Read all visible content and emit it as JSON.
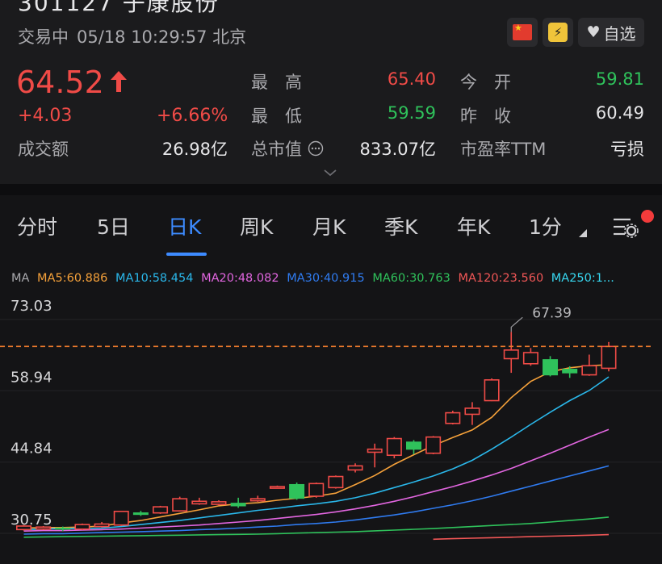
{
  "header": {
    "title_partial": "301127 子康股份",
    "status": "交易中",
    "datetime": "05/18 10:29:57 北京",
    "watch_label": "自选"
  },
  "quote": {
    "price": "64.52",
    "change": "+4.03",
    "change_pct": "+6.66%",
    "turnover_label": "成交额",
    "turnover_value": "26.98亿",
    "high_label": "最　高",
    "high_value": "65.40",
    "open_label": "今　开",
    "open_value": "59.81",
    "low_label": "最　低",
    "low_value": "59.59",
    "prev_close_label": "昨　收",
    "prev_close_value": "60.49",
    "mcap_label": "总市值",
    "mcap_value": "833.07亿",
    "pe_label": "市盈率TTM",
    "pe_value": "亏损"
  },
  "tabs": [
    "分时",
    "5日",
    "日K",
    "周K",
    "月K",
    "季K",
    "年K",
    "1分"
  ],
  "active_tab": "日K",
  "ma": {
    "label": "MA",
    "ma5": "MA5:60.886",
    "ma10": "MA10:58.454",
    "ma20": "MA20:48.082",
    "ma30": "MA30:40.915",
    "ma60": "MA60:30.763",
    "ma120": "MA120:23.560",
    "ma250": "MA250:1..."
  },
  "colors": {
    "up": "#f04b47",
    "down": "#2fc25b",
    "accent": "#3d8bff",
    "ma5": "#f5a13a",
    "ma10": "#2ab7ea",
    "ma20": "#e266e0",
    "ma30": "#2f7bf0",
    "ma60": "#2fc25b",
    "ma120": "#f05656",
    "ma250": "#37d7f0"
  },
  "chart_data": {
    "type": "candlestick",
    "y_ticks": [
      "73.03",
      "58.94",
      "44.84",
      "30.75"
    ],
    "ylim": [
      27.2,
      73.03
    ],
    "max_label": "67.39",
    "current_price_line": 64.52,
    "candles": [
      {
        "o": 28.3,
        "c": 29.0,
        "h": 29.2,
        "l": 28.1
      },
      {
        "o": 28.4,
        "c": 28.8,
        "h": 29.0,
        "l": 28.2
      },
      {
        "o": 28.7,
        "c": 28.3,
        "h": 28.9,
        "l": 28.0
      },
      {
        "o": 28.4,
        "c": 29.3,
        "h": 29.5,
        "l": 28.2
      },
      {
        "o": 28.9,
        "c": 29.4,
        "h": 29.8,
        "l": 28.7
      },
      {
        "o": 29.2,
        "c": 31.9,
        "h": 32.0,
        "l": 29.0
      },
      {
        "o": 31.7,
        "c": 31.2,
        "h": 32.0,
        "l": 31.0
      },
      {
        "o": 31.6,
        "c": 32.8,
        "h": 33.0,
        "l": 31.4
      },
      {
        "o": 32.0,
        "c": 34.4,
        "h": 34.8,
        "l": 31.9
      },
      {
        "o": 33.4,
        "c": 33.9,
        "h": 34.6,
        "l": 33.2
      },
      {
        "o": 33.3,
        "c": 33.8,
        "h": 34.1,
        "l": 33.1
      },
      {
        "o": 33.6,
        "c": 32.9,
        "h": 34.6,
        "l": 32.6
      },
      {
        "o": 34.0,
        "c": 34.4,
        "h": 35.0,
        "l": 33.8
      },
      {
        "o": 36.6,
        "c": 36.8,
        "h": 37.0,
        "l": 36.6
      },
      {
        "o": 37.3,
        "c": 34.4,
        "h": 37.6,
        "l": 34.2
      },
      {
        "o": 34.9,
        "c": 37.4,
        "h": 37.6,
        "l": 34.6
      },
      {
        "o": 36.6,
        "c": 38.8,
        "h": 39.0,
        "l": 36.4
      },
      {
        "o": 40.1,
        "c": 40.9,
        "h": 41.4,
        "l": 39.6
      },
      {
        "o": 43.6,
        "c": 44.2,
        "h": 45.3,
        "l": 40.6
      },
      {
        "o": 43.0,
        "c": 46.3,
        "h": 46.6,
        "l": 42.4
      },
      {
        "o": 45.7,
        "c": 44.1,
        "h": 46.0,
        "l": 43.2
      },
      {
        "o": 43.4,
        "c": 46.6,
        "h": 46.8,
        "l": 43.2
      },
      {
        "o": 49.3,
        "c": 51.4,
        "h": 51.8,
        "l": 49.1
      },
      {
        "o": 51.1,
        "c": 52.3,
        "h": 53.5,
        "l": 49.0
      },
      {
        "o": 53.8,
        "c": 57.9,
        "h": 58.2,
        "l": 53.7
      },
      {
        "o": 62.1,
        "c": 63.8,
        "h": 67.39,
        "l": 59.3
      },
      {
        "o": 61.1,
        "c": 63.3,
        "h": 64.2,
        "l": 60.7
      },
      {
        "o": 62.0,
        "c": 58.8,
        "h": 62.6,
        "l": 58.6
      },
      {
        "o": 60.1,
        "c": 59.2,
        "h": 60.6,
        "l": 58.3
      },
      {
        "o": 58.9,
        "c": 60.7,
        "h": 62.9,
        "l": 58.7
      },
      {
        "o": 60.2,
        "c": 64.52,
        "h": 65.4,
        "l": 59.59
      }
    ],
    "ma_series": [
      {
        "name": "MA5",
        "values": [
          28.6,
          28.7,
          28.7,
          28.8,
          29.0,
          29.6,
          30.1,
          30.8,
          31.5,
          32.2,
          33.0,
          33.4,
          33.6,
          34.1,
          34.5,
          34.9,
          35.5,
          37.2,
          39.0,
          41.2,
          43.1,
          44.9,
          46.5,
          48.0,
          50.5,
          54.4,
          57.6,
          59.5,
          60.3,
          60.7,
          60.9
        ]
      },
      {
        "name": "MA10",
        "values": [
          28.3,
          28.4,
          28.5,
          28.5,
          28.6,
          28.9,
          29.3,
          29.7,
          30.1,
          30.6,
          31.1,
          31.6,
          32.1,
          32.5,
          33.0,
          33.4,
          33.9,
          34.6,
          35.5,
          36.6,
          37.7,
          38.9,
          40.3,
          42.0,
          44.2,
          46.6,
          49.1,
          51.5,
          53.8,
          55.8,
          58.5
        ]
      },
      {
        "name": "MA20",
        "values": [
          28.0,
          28.1,
          28.1,
          28.2,
          28.3,
          28.4,
          28.6,
          28.8,
          29.0,
          29.2,
          29.5,
          29.8,
          30.1,
          30.5,
          30.9,
          31.3,
          31.8,
          32.4,
          33.1,
          33.9,
          34.8,
          35.8,
          36.8,
          37.9,
          39.1,
          40.4,
          41.9,
          43.4,
          45.0,
          46.6,
          48.1
        ]
      },
      {
        "name": "MA30",
        "values": [
          27.4,
          27.5,
          27.5,
          27.6,
          27.7,
          27.8,
          27.9,
          28.0,
          28.1,
          28.3,
          28.4,
          28.6,
          28.8,
          29.0,
          29.3,
          29.5,
          29.8,
          30.2,
          30.7,
          31.2,
          31.8,
          32.5,
          33.2,
          34.0,
          34.9,
          35.9,
          36.9,
          37.9,
          38.9,
          39.9,
          40.9
        ]
      },
      {
        "name": "MA60",
        "values": [
          26.8,
          26.85,
          26.9,
          26.95,
          27.0,
          27.05,
          27.1,
          27.15,
          27.2,
          27.25,
          27.3,
          27.35,
          27.4,
          27.5,
          27.6,
          27.7,
          27.8,
          27.9,
          28.05,
          28.2,
          28.35,
          28.5,
          28.7,
          28.9,
          29.1,
          29.3,
          29.5,
          29.8,
          30.1,
          30.4,
          30.76
        ]
      },
      {
        "name": "MA120",
        "values": [
          null,
          null,
          null,
          null,
          null,
          null,
          null,
          null,
          null,
          null,
          null,
          null,
          null,
          null,
          null,
          null,
          null,
          null,
          null,
          null,
          null,
          26.4,
          26.5,
          26.6,
          26.7,
          26.8,
          26.9,
          27.0,
          27.1,
          27.2,
          27.3
        ]
      }
    ]
  }
}
